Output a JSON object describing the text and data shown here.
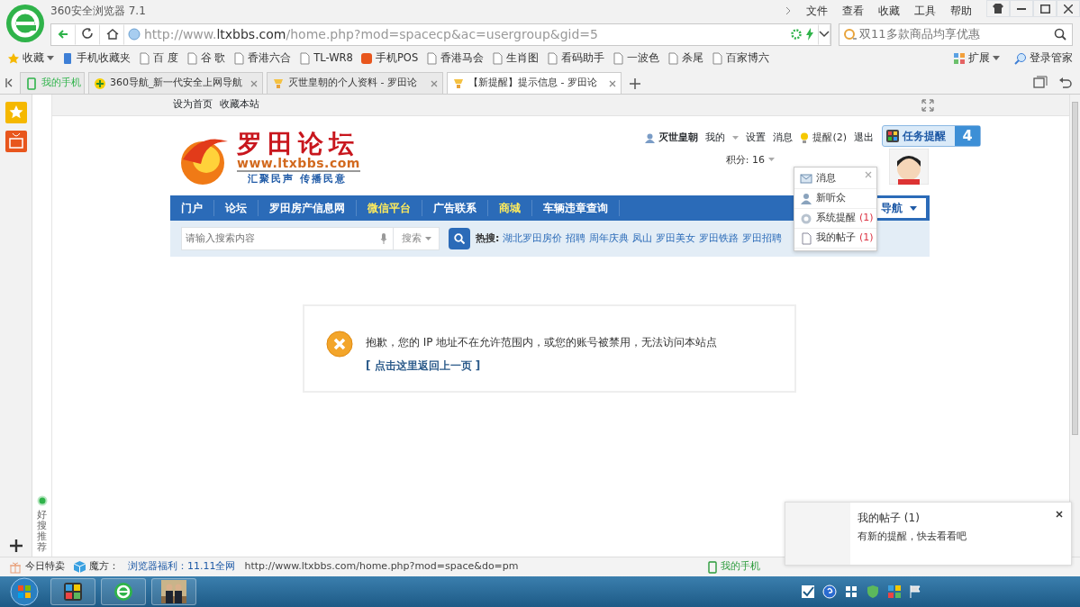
{
  "browser": {
    "title": "360安全浏览器 7.1",
    "menu": [
      "文件",
      "查看",
      "收藏",
      "工具",
      "帮助"
    ],
    "address": {
      "scheme": "http://www.",
      "host": "ltxbbs.com",
      "path": "/home.php?mod=spacecp&ac=usergroup&gid=5"
    },
    "search": {
      "placeholder": "双11多款商品均享优惠"
    },
    "bookmarks": [
      {
        "label": "收藏",
        "kind": "favorites"
      },
      {
        "label": "手机收藏夹",
        "kind": "phone"
      },
      {
        "label": "百 度",
        "kind": "page"
      },
      {
        "label": "谷 歌",
        "kind": "page"
      },
      {
        "label": "香港六合",
        "kind": "page"
      },
      {
        "label": "TL-WR8",
        "kind": "page"
      },
      {
        "label": "手机POS",
        "kind": "shop"
      },
      {
        "label": "香港马会",
        "kind": "page"
      },
      {
        "label": "生肖图",
        "kind": "page"
      },
      {
        "label": "看码助手",
        "kind": "page"
      },
      {
        "label": "一波色",
        "kind": "page"
      },
      {
        "label": "杀尾",
        "kind": "page"
      },
      {
        "label": "百家博六",
        "kind": "page"
      }
    ],
    "extensions": [
      "扩展",
      "登录管家"
    ],
    "tabs": [
      {
        "label": "我的手机",
        "kind": "phone",
        "selected": false
      },
      {
        "label": "360导航_新一代安全上网导航",
        "kind": "nav",
        "selected": false
      },
      {
        "label": "灭世皇朝的个人资料 - 罗田论",
        "kind": "site",
        "selected": false
      },
      {
        "label": "【新提醒】提示信息 - 罗田论",
        "kind": "site",
        "selected": true
      }
    ]
  },
  "sidebar": {
    "label": "好搜推荐"
  },
  "forum": {
    "top_links": [
      "设为首页",
      "收藏本站"
    ],
    "logo": {
      "name": "罗田论坛",
      "url": "www.ltxbbs.com",
      "slogan": "汇聚民声 传播民意"
    },
    "user": {
      "name": "灭世皇朝",
      "links": [
        "我的",
        "设置",
        "消息",
        "提醒(2)",
        "退出"
      ],
      "points": "积分: 16"
    },
    "task": {
      "label": "任务提醒",
      "count": "4"
    },
    "notice_menu": [
      {
        "label": "消息",
        "kind": "mail"
      },
      {
        "label": "新听众",
        "kind": "user"
      },
      {
        "label": "系统提醒",
        "count": "(1)",
        "kind": "gear"
      },
      {
        "label": "我的帖子",
        "count": "(1)",
        "kind": "doc"
      }
    ],
    "nav": [
      {
        "label": "门户",
        "highlight": false
      },
      {
        "label": "论坛",
        "highlight": false
      },
      {
        "label": "罗田房产信息网",
        "highlight": false
      },
      {
        "label": "微信平台",
        "highlight": true
      },
      {
        "label": "广告联系",
        "highlight": false
      },
      {
        "label": "商城",
        "highlight": true
      },
      {
        "label": "车辆违章查询",
        "highlight": false
      }
    ],
    "nav_more": "导航",
    "search": {
      "placeholder": "请输入搜索内容",
      "scope": "搜索",
      "hot_label": "热搜:",
      "hot": [
        "湖北罗田房价",
        "招聘",
        "周年庆典",
        "凤山",
        "罗田美女",
        "罗田铁路",
        "罗田招聘"
      ]
    },
    "message": {
      "text": "抱歉，您的 IP 地址不在允许范围内，或您的账号被禁用，无法访问本站点",
      "link": "[ 点击这里返回上一页 ]"
    }
  },
  "toast": {
    "title": "我的帖子 (1)",
    "body": "有新的提醒，快去看看吧"
  },
  "status_bar": {
    "sale": "今日特卖",
    "cube": "魔方：",
    "promo": "浏览器福利：11.11全网",
    "url": "http://www.ltxbbs.com/home.php?mod=space&do=pm",
    "phone": "我的手机"
  }
}
